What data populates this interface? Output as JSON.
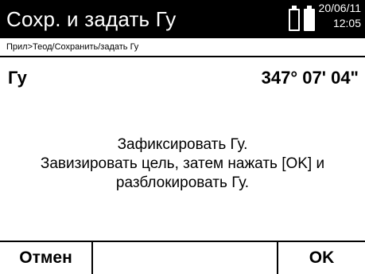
{
  "header": {
    "title": "Сохр. и задать Гу",
    "date": "20/06/11",
    "time": "12:05",
    "battery_icons": [
      "battery-empty-icon",
      "battery-full-icon"
    ]
  },
  "breadcrumb": "Прил>Теод/Сохранить/задать Гу",
  "measurement": {
    "label": "Гу",
    "value": "347° 07' 04\""
  },
  "message": {
    "line1": "Зафиксировать Гу.",
    "line2": "Завизировать цель, затем нажать [OK] и",
    "line3": "разблокировать Гу."
  },
  "softkeys": {
    "cancel": "Отмен",
    "middle": "",
    "ok": "OK"
  },
  "colors": {
    "titlebar_bg": "#000000",
    "titlebar_fg": "#ffffff",
    "background": "#ffffff"
  }
}
